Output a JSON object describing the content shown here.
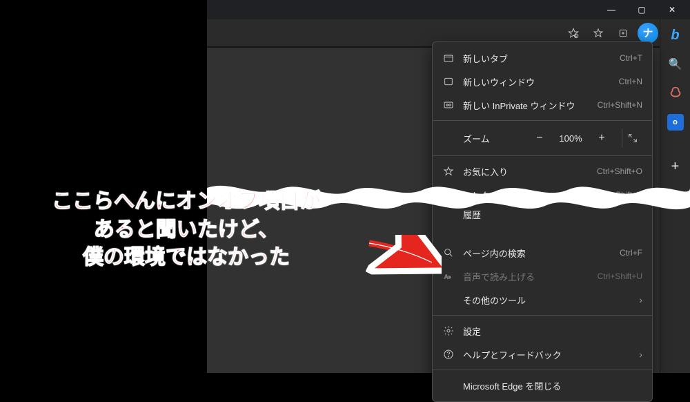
{
  "window_controls": {
    "min": "—",
    "max": "▢",
    "close": "✕"
  },
  "toolbar": {
    "tracking_icon": "tracking-prevention-icon",
    "favorites_icon": "favorites-star-icon",
    "collections_icon": "collections-icon",
    "nav_symbol": "ナ",
    "more_glyph": "···"
  },
  "sidebar": {
    "bing_glyph": "b",
    "search_glyph": "🔍",
    "outlook_glyph": "o",
    "plus_glyph": "+"
  },
  "menu": {
    "new_tab": {
      "label": "新しいタブ",
      "shortcut": "Ctrl+T"
    },
    "new_window": {
      "label": "新しいウィンドウ",
      "shortcut": "Ctrl+N"
    },
    "new_inprivate": {
      "label": "新しい InPrivate ウィンドウ",
      "shortcut": "Ctrl+Shift+N"
    },
    "zoom_label": "ズーム",
    "zoom_value": "100%",
    "favorites": {
      "label": "お気に入り",
      "shortcut": "Ctrl+Shift+O"
    },
    "collections": {
      "label": "コレクション",
      "shortcut": "Ctrl+Shift+Y"
    },
    "history": {
      "label": "履歴",
      "shortcut": ""
    },
    "find": {
      "label": "ページ内の検索",
      "shortcut": "Ctrl+F"
    },
    "read_aloud": {
      "label": "音声で読み上げる",
      "shortcut": "Ctrl+Shift+U"
    },
    "more_tools": {
      "label": "その他のツール"
    },
    "settings": {
      "label": "設定"
    },
    "help": {
      "label": "ヘルプとフィードバック"
    },
    "close_edge": {
      "label": "Microsoft Edge を閉じる"
    }
  },
  "annotation": {
    "text": "ここらへんにオンオフ項目が\nあると聞いたけど、\n僕の環境ではなかった",
    "color": "#ff3b2f"
  }
}
